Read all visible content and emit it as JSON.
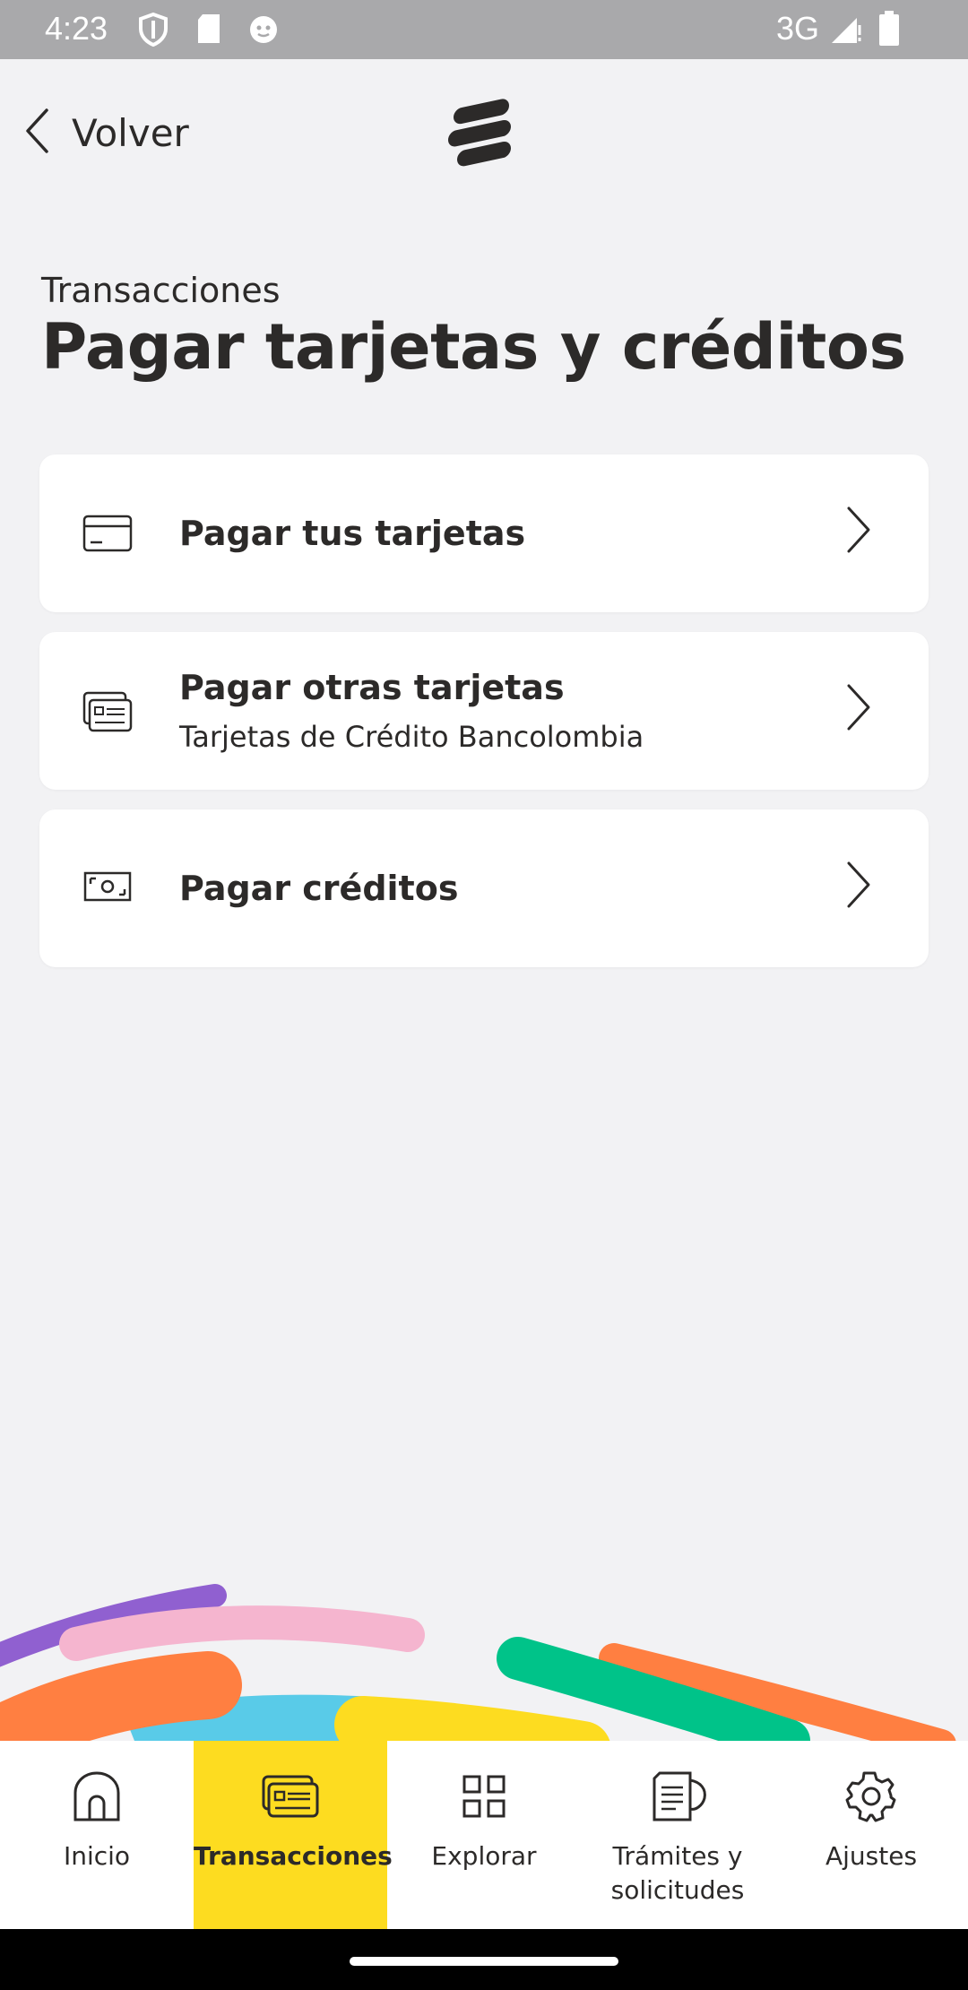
{
  "status_bar": {
    "time": "4:23",
    "network": "3G"
  },
  "header": {
    "back_label": "Volver"
  },
  "page": {
    "subtitle": "Transacciones",
    "title": "Pagar tarjetas y créditos"
  },
  "options": [
    {
      "title": "Pagar tus tarjetas",
      "icon": "credit-card-icon"
    },
    {
      "title": "Pagar otras tarjetas",
      "subtitle": "Tarjetas de Crédito Bancolombia",
      "icon": "cards-icon"
    },
    {
      "title": "Pagar créditos",
      "icon": "banknote-icon"
    }
  ],
  "bottom_nav": [
    {
      "label": "Inicio",
      "icon": "home-icon"
    },
    {
      "label": "Transacciones",
      "icon": "transactions-icon",
      "active": true
    },
    {
      "label": "Explorar",
      "icon": "grid-icon"
    },
    {
      "label": "Trámites y solicitudes",
      "icon": "documents-icon"
    },
    {
      "label": "Ajustes",
      "icon": "gear-icon"
    }
  ],
  "colors": {
    "accent": "#fddc20",
    "background": "#f2f2f4",
    "text": "#2c2a29",
    "deco_purple": "#9060d0",
    "deco_pink": "#f5b5cf",
    "deco_orange": "#ff7f41",
    "deco_blue": "#59cbe8",
    "deco_yellow": "#fddc20",
    "deco_green": "#00c389"
  }
}
